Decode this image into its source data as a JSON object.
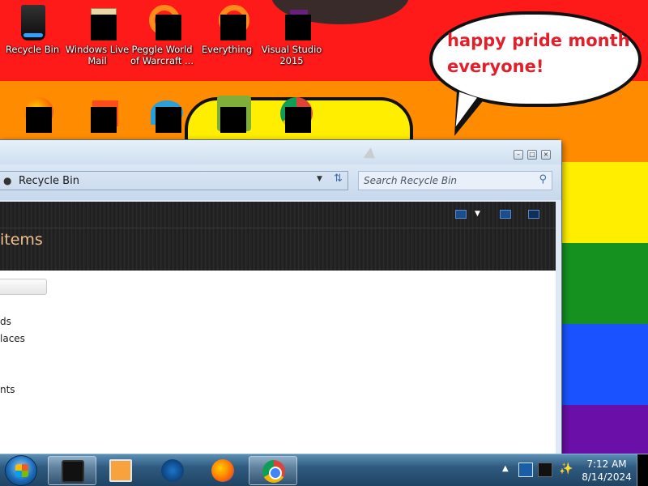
{
  "desktop": {
    "bubble_text": "happy pride month everyone!",
    "icons_row1": [
      {
        "label": "Recycle Bin",
        "icon": "recycle-bin-icon"
      },
      {
        "label": "Windows Live Mail",
        "icon": "mail-icon"
      },
      {
        "label": "Peggle World of Warcraft ...",
        "icon": "peggle-icon"
      },
      {
        "label": "Everything",
        "icon": "everything-icon"
      },
      {
        "label": "Visual Studio 2015",
        "icon": "visual-studio-icon"
      }
    ],
    "icons_row2": [
      {
        "label": "",
        "icon": "firefox-icon"
      },
      {
        "label": "",
        "icon": "office-icon"
      },
      {
        "label": "",
        "icon": "thunderbird-icon"
      },
      {
        "label": "",
        "icon": "zuma-icon"
      },
      {
        "label": "",
        "icon": "chrome-icon"
      }
    ]
  },
  "window": {
    "address": "Recycle Bin",
    "search_placeholder": "Search Recycle Bin",
    "banner_title": "items",
    "nav_items": [
      "ds",
      "laces",
      "nts"
    ]
  },
  "taskbar": {
    "time": "7:12 AM",
    "date": "8/14/2024"
  },
  "colors": {
    "stripe_red": "#ff1a1a",
    "stripe_orange": "#ff8c00",
    "stripe_yellow": "#ffee00",
    "stripe_green": "#14911f",
    "stripe_blue": "#1a52ff",
    "stripe_purple": "#6a0fa8",
    "bubble_text": "#e0202a"
  }
}
